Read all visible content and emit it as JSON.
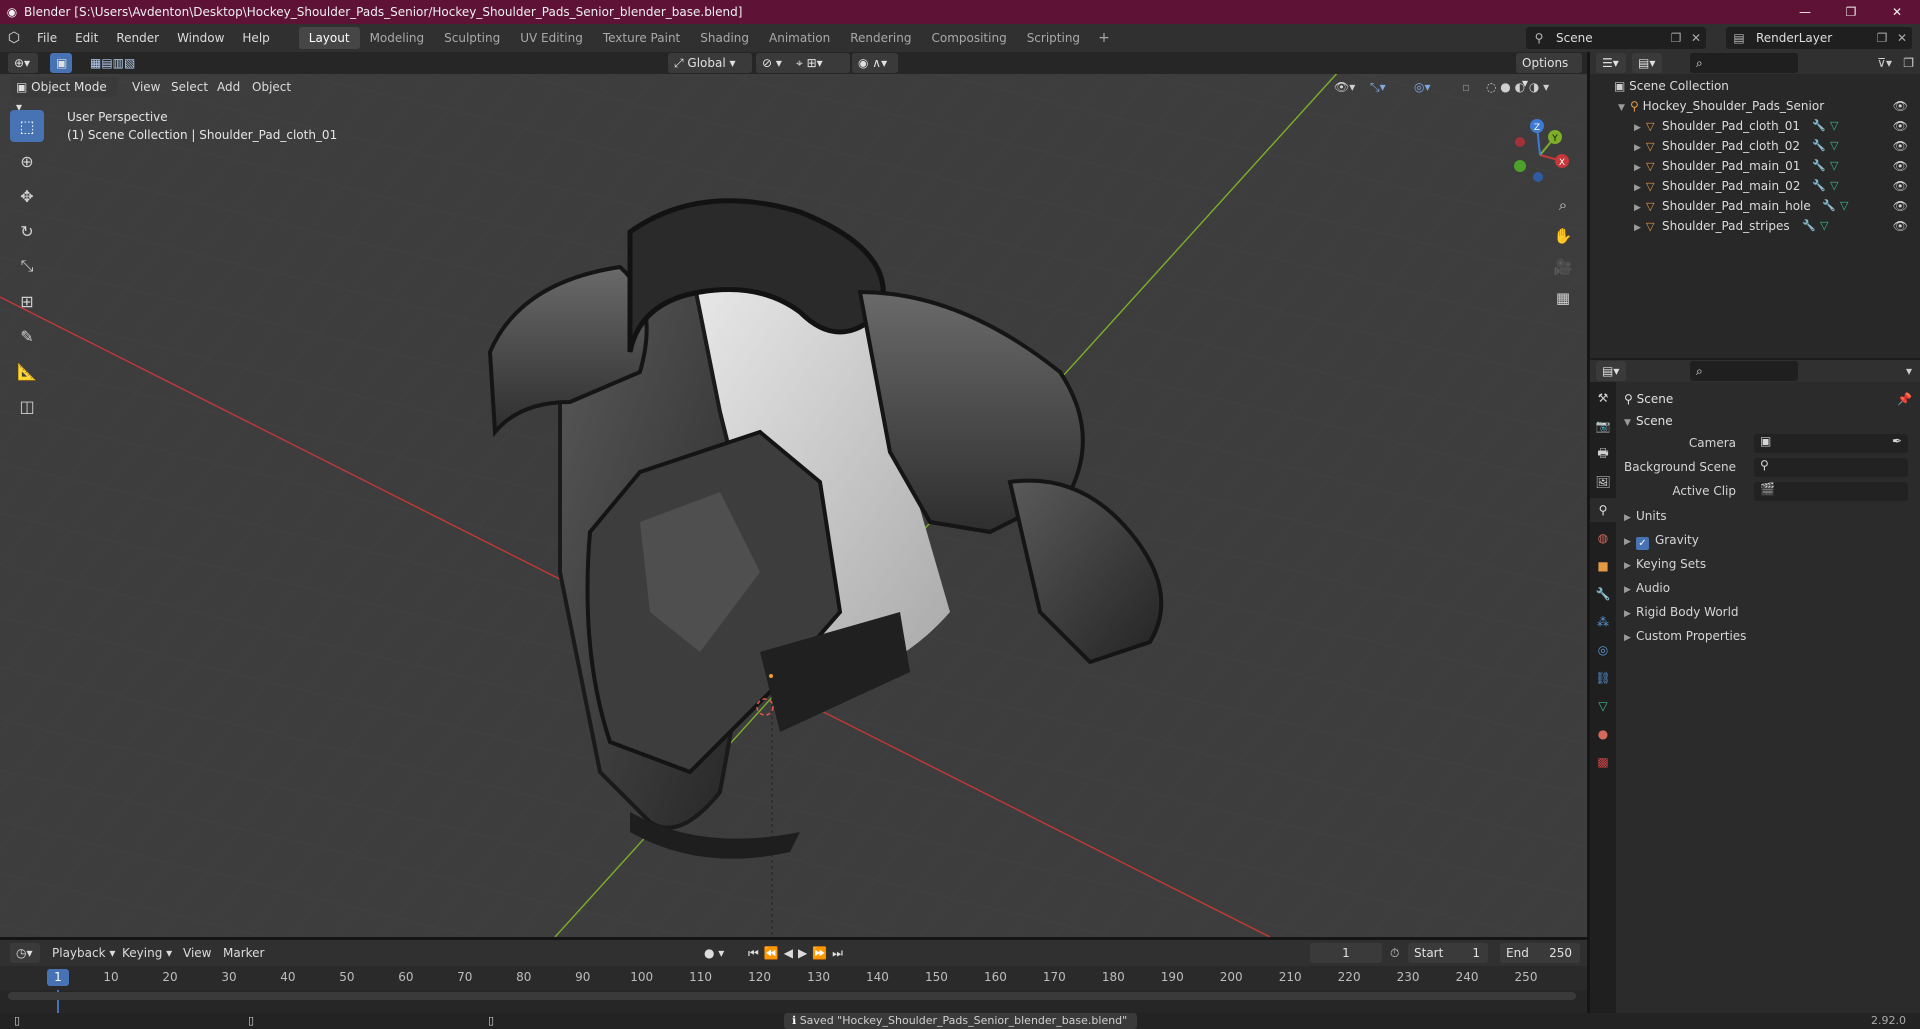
{
  "window": {
    "title": "Blender [S:\\Users\\Avdenton\\Desktop\\Hockey_Shoulder_Pads_Senior/Hockey_Shoulder_Pads_Senior_blender_base.blend]",
    "controls": [
      "—",
      "❐",
      "✕"
    ]
  },
  "menu": [
    "File",
    "Edit",
    "Render",
    "Window",
    "Help"
  ],
  "workspaces": [
    {
      "label": "Layout",
      "active": true
    },
    {
      "label": "Modeling"
    },
    {
      "label": "Sculpting"
    },
    {
      "label": "UV Editing"
    },
    {
      "label": "Texture Paint"
    },
    {
      "label": "Shading"
    },
    {
      "label": "Animation"
    },
    {
      "label": "Rendering"
    },
    {
      "label": "Compositing"
    },
    {
      "label": "Scripting"
    }
  ],
  "scene_selector": {
    "value": "Scene"
  },
  "view_layer_selector": {
    "value": "RenderLayer"
  },
  "viewport_header": {
    "mode": "Object Mode",
    "menus": [
      "View",
      "Select",
      "Add",
      "Object"
    ],
    "transform_orientation": "Global",
    "options_label": "Options"
  },
  "viewport_info": {
    "line1": "User Perspective",
    "line2": "(1) Scene Collection | Shoulder_Pad_cloth_01"
  },
  "gizmo": {
    "x": "X",
    "y": "Y",
    "z": "Z"
  },
  "outliner": {
    "root": "Scene Collection",
    "collection": "Hockey_Shoulder_Pads_Senior",
    "objects": [
      "Shoulder_Pad_cloth_01",
      "Shoulder_Pad_cloth_02",
      "Shoulder_Pad_main_01",
      "Shoulder_Pad_main_02",
      "Shoulder_Pad_main_hole",
      "Shoulder_Pad_stripes"
    ]
  },
  "properties": {
    "context_title": "Scene",
    "panel_title": "Scene",
    "fields": [
      {
        "label": "Camera"
      },
      {
        "label": "Background Scene"
      },
      {
        "label": "Active Clip"
      }
    ],
    "subpanels": [
      "Units",
      "Gravity",
      "Keying Sets",
      "Audio",
      "Rigid Body World",
      "Custom Properties"
    ],
    "gravity_enabled": true
  },
  "timeline": {
    "menus": [
      "Playback",
      "Keying",
      "View",
      "Marker"
    ],
    "current_frame": "1",
    "start_label": "Start",
    "start_value": "1",
    "end_label": "End",
    "end_value": "250",
    "ruler_ticks": [
      "10",
      "20",
      "30",
      "40",
      "50",
      "60",
      "70",
      "80",
      "90",
      "100",
      "110",
      "120",
      "130",
      "140",
      "150",
      "160",
      "170",
      "180",
      "190",
      "200",
      "210",
      "220",
      "230",
      "240",
      "250"
    ],
    "cursor_label": "1"
  },
  "status": {
    "message": "Saved \"Hockey_Shoulder_Pads_Senior_blender_base.blend\"",
    "version": "2.92.0"
  },
  "colors": {
    "title_bar": "#5d1236",
    "accent": "#4772b3",
    "x_axis": "#c5383a",
    "y_axis": "#7cae2a",
    "z_axis": "#3d7ad6"
  }
}
